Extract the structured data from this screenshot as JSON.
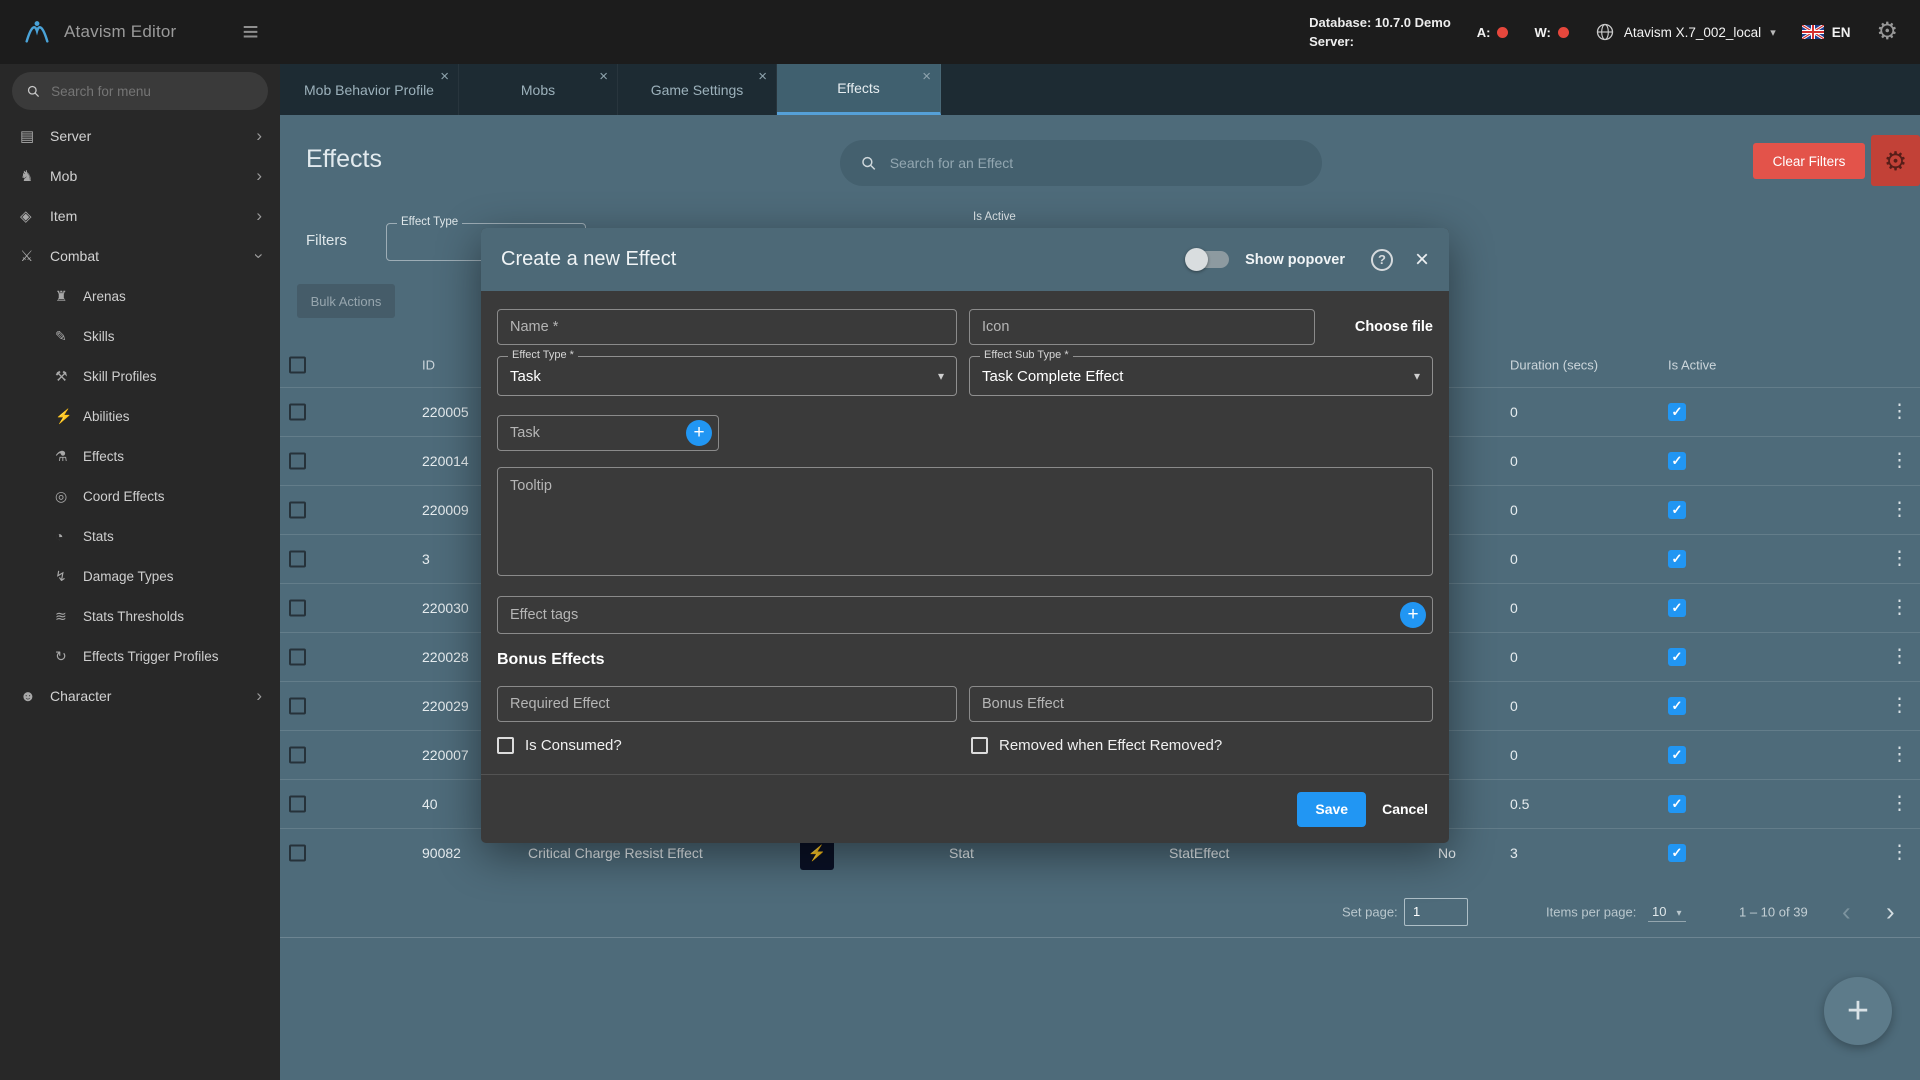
{
  "colors": {
    "accent_blue": "#2196f3",
    "danger_red": "#e3534a",
    "status_dot_red": "#e6473c",
    "content_bg": "#4e6b7a"
  },
  "icons": {
    "hamburger": "≡",
    "gear": "⚙",
    "caret_down": "▾",
    "chevron_right": "›",
    "close": "×",
    "check": "✓",
    "plus": "+",
    "question": "?",
    "dots_vertical": "⋮",
    "page_prev": "‹",
    "page_next": "›",
    "bolt": "⚡"
  },
  "topbar": {
    "app_title": "Atavism Editor",
    "database_line1": "Database: 10.7.0 Demo",
    "database_line2": "Server:",
    "a_label": "A:",
    "w_label": "W:",
    "world_name": "Atavism X.7_002_local",
    "language": "EN"
  },
  "sidebar": {
    "search_placeholder": "Search for menu",
    "items": [
      {
        "label": "Server",
        "glyph": "▤"
      },
      {
        "label": "Mob",
        "glyph": "♞"
      },
      {
        "label": "Item",
        "glyph": "◈"
      },
      {
        "label": "Combat",
        "glyph": "⚔"
      },
      {
        "label": "Arenas",
        "glyph": "♜"
      },
      {
        "label": "Skills",
        "glyph": "✎"
      },
      {
        "label": "Skill Profiles",
        "glyph": "⚒"
      },
      {
        "label": "Abilities",
        "glyph": "⚡"
      },
      {
        "label": "Effects",
        "glyph": "⚗"
      },
      {
        "label": "Coord Effects",
        "glyph": "◎"
      },
      {
        "label": "Stats",
        "glyph": "◔"
      },
      {
        "label": "Damage Types",
        "glyph": "↯"
      },
      {
        "label": "Stats Thresholds",
        "glyph": "≋"
      },
      {
        "label": "Effects Trigger Profiles",
        "glyph": "↻"
      },
      {
        "label": "Character",
        "glyph": "☻"
      }
    ]
  },
  "tabs": [
    {
      "label": "Mob Behavior Profile"
    },
    {
      "label": "Mobs"
    },
    {
      "label": "Game Settings"
    },
    {
      "label": "Effects"
    }
  ],
  "page": {
    "title": "Effects",
    "search_placeholder": "Search for an Effect",
    "clear_filters": "Clear Filters",
    "filters_label": "Filters",
    "effect_type_filter_label": "Effect Type",
    "is_active_filter_label": "Is Active",
    "bulk_actions": "Bulk Actions"
  },
  "table": {
    "headers": {
      "id": "ID",
      "duration": "Duration (secs)",
      "is_active": "Is Active"
    },
    "rows": [
      {
        "id": "220005",
        "duration": "0"
      },
      {
        "id": "220014",
        "duration": "0"
      },
      {
        "id": "220009",
        "duration": "0"
      },
      {
        "id": "3",
        "duration": "0"
      },
      {
        "id": "220030",
        "duration": "0"
      },
      {
        "id": "220028",
        "duration": "0"
      },
      {
        "id": "220029",
        "duration": "0"
      },
      {
        "id": "220007",
        "duration": "0"
      },
      {
        "id": "40",
        "duration": "0.5"
      },
      {
        "id": "90082",
        "name": "Critical Charge Resist Effect",
        "effect_type": "Stat",
        "effect_sub_type": "StatEffect",
        "passive": "No",
        "duration": "3"
      }
    ]
  },
  "pagination": {
    "set_page_label": "Set page:",
    "page_value": "1",
    "items_per_page_label": "Items per page:",
    "items_per_page_value": "10",
    "range": "1 – 10 of 39"
  },
  "modal": {
    "title": "Create a new Effect",
    "show_popover": "Show popover",
    "name_placeholder": "Name *",
    "icon_placeholder": "Icon",
    "choose_file": "Choose file",
    "effect_type_label": "Effect Type *",
    "effect_type_value": "Task",
    "effect_sub_type_label": "Effect Sub Type *",
    "effect_sub_type_value": "Task Complete Effect",
    "task_placeholder": "Task",
    "tooltip_placeholder": "Tooltip",
    "effect_tags_placeholder": "Effect tags",
    "bonus_effects_heading": "Bonus Effects",
    "required_effect_placeholder": "Required Effect",
    "bonus_effect_placeholder": "Bonus Effect",
    "is_consumed_label": "Is Consumed?",
    "removed_label": "Removed when Effect Removed?",
    "save": "Save",
    "cancel": "Cancel"
  }
}
